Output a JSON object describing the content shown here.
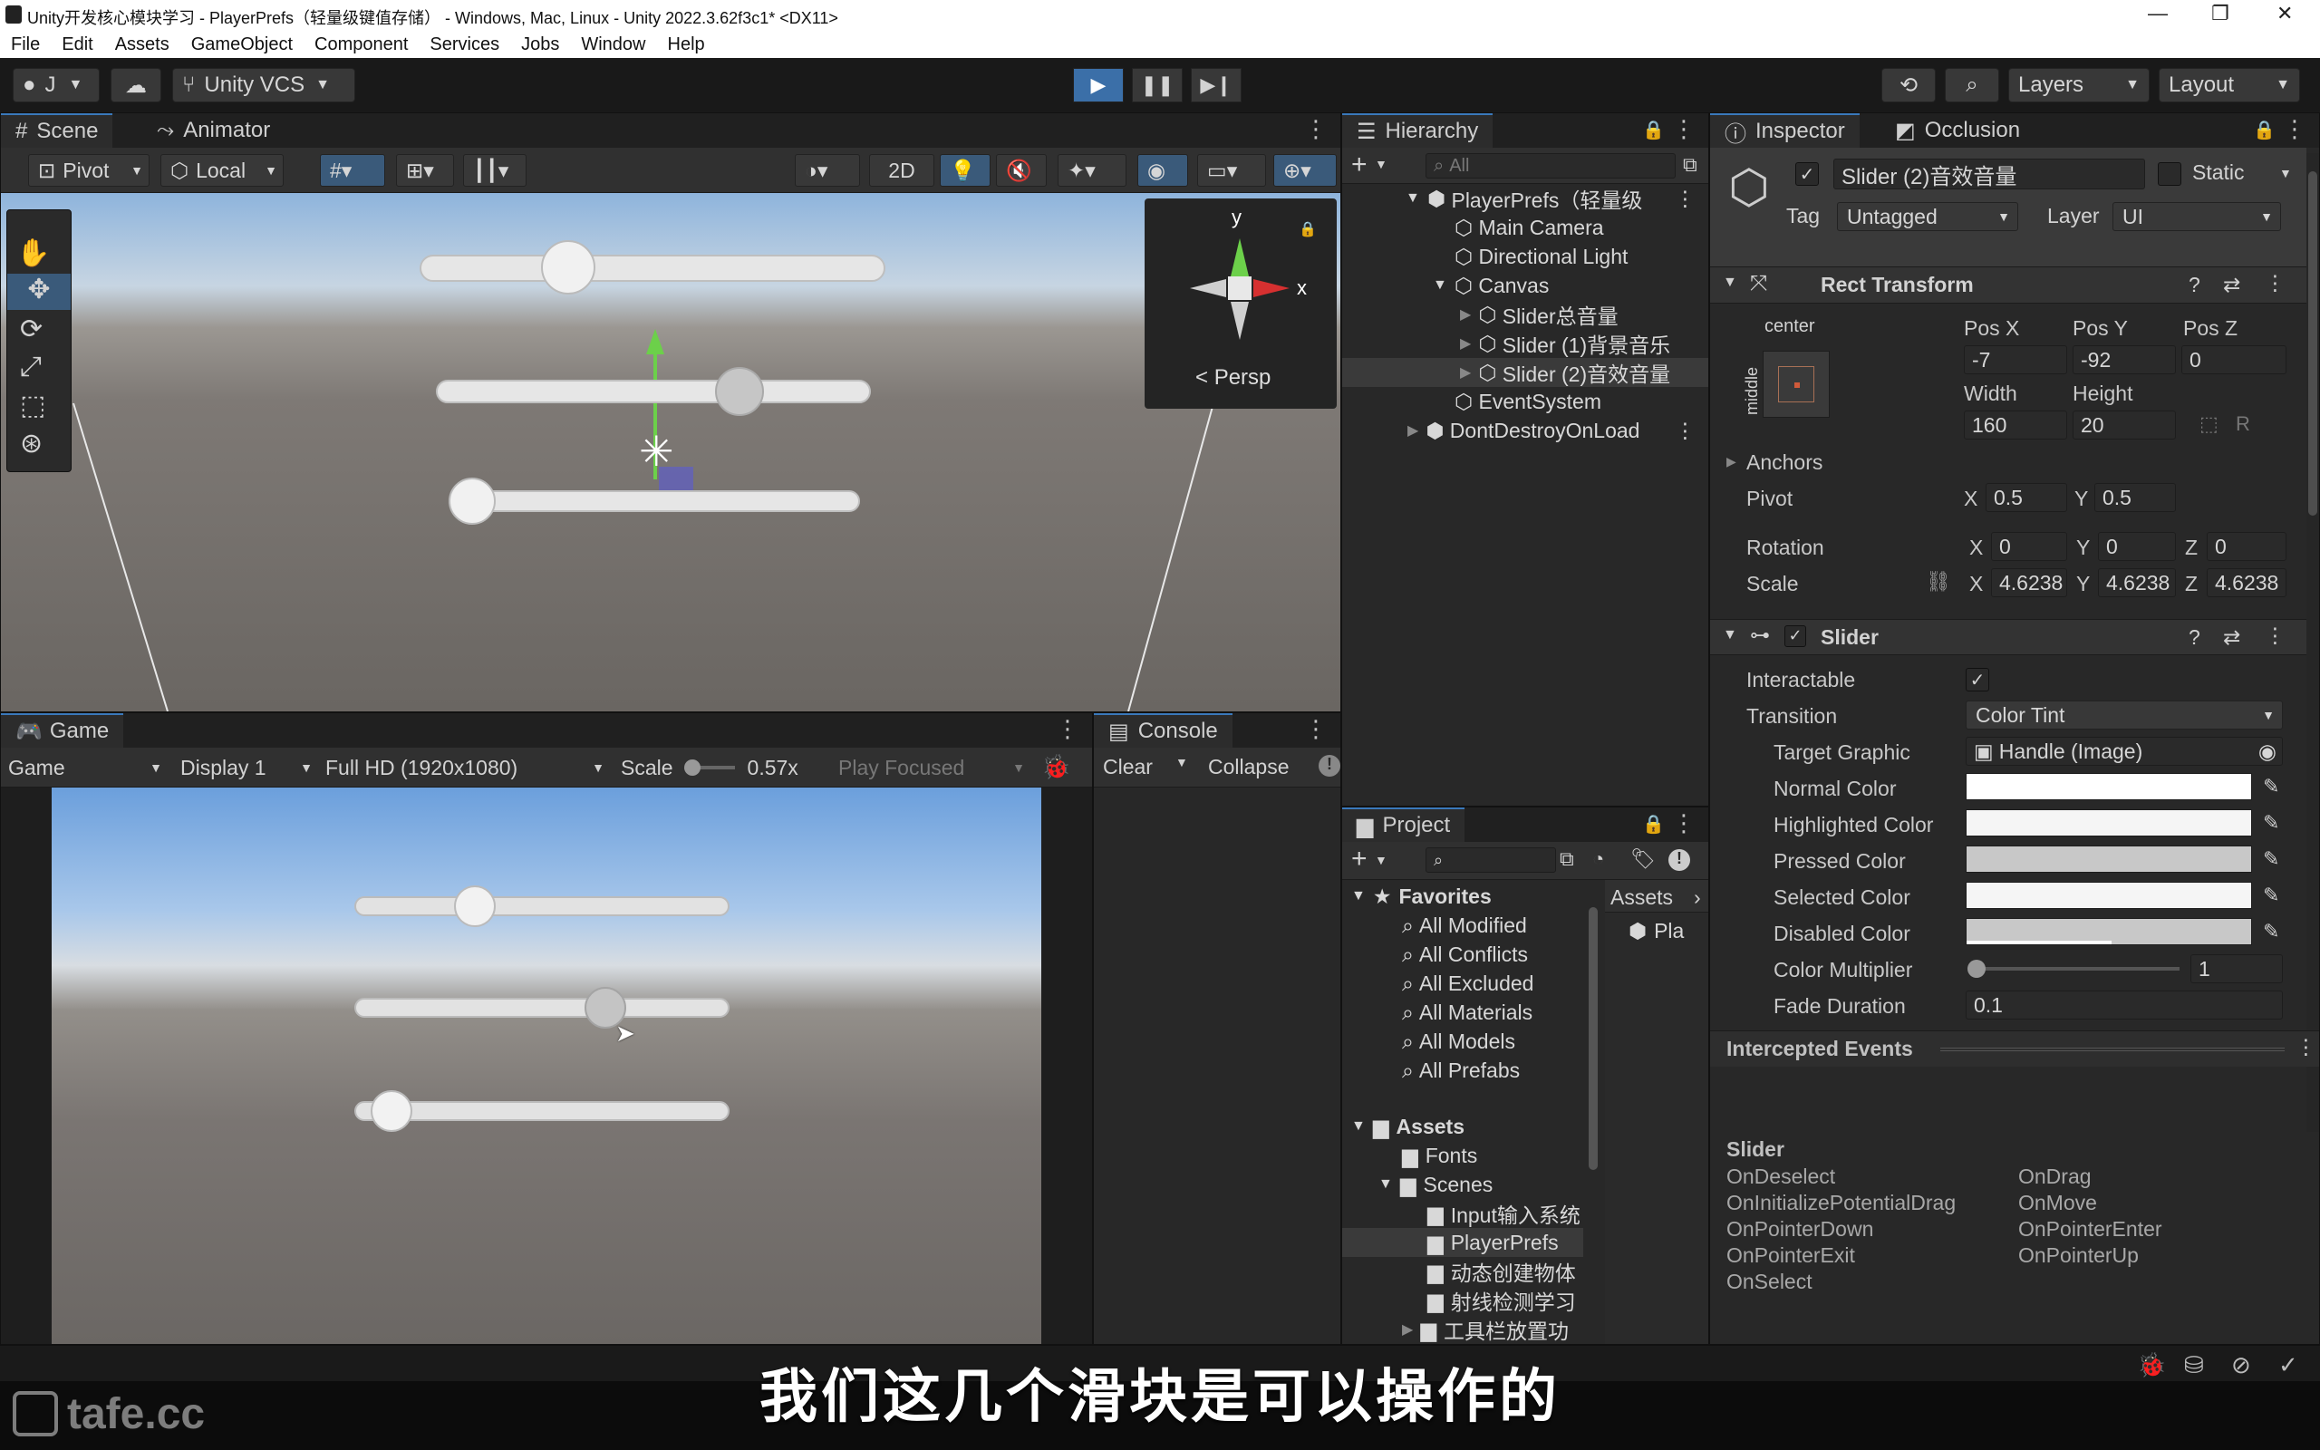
{
  "window": {
    "title": "Unity开发核心模块学习 - PlayerPrefs（轻量级键值存储） - Windows, Mac, Linux - Unity 2022.3.62f3c1* <DX11>"
  },
  "menu": [
    "File",
    "Edit",
    "Assets",
    "GameObject",
    "Component",
    "Services",
    "Jobs",
    "Window",
    "Help"
  ],
  "toolbar": {
    "account": "J",
    "vcs": "Unity VCS",
    "layers": "Layers",
    "layout": "Layout"
  },
  "scene": {
    "tabs": [
      "Scene",
      "Animator"
    ],
    "pivot": "Pivot",
    "local": "Local",
    "mode_2d": "2D",
    "persp": "Persp",
    "gizmo_y": "y",
    "gizmo_x": "x"
  },
  "game": {
    "tab": "Game",
    "mode": "Game",
    "display": "Display 1",
    "resolution": "Full HD (1920x1080)",
    "scale_label": "Scale",
    "scale_value": "0.57x",
    "play_focused": "Play Focused",
    "sliders": [
      0.3,
      0.69,
      0.05
    ]
  },
  "console": {
    "tab": "Console",
    "clear": "Clear",
    "collapse": "Collapse"
  },
  "hierarchy": {
    "tab": "Hierarchy",
    "search_placeholder": "All",
    "items": [
      {
        "label": "PlayerPrefs（轻量级",
        "indent": 0
      },
      {
        "label": "Main Camera",
        "indent": 1
      },
      {
        "label": "Directional Light",
        "indent": 1
      },
      {
        "label": "Canvas",
        "indent": 1
      },
      {
        "label": "Slider总音量",
        "indent": 2
      },
      {
        "label": "Slider (1)背景音乐",
        "indent": 2
      },
      {
        "label": "Slider (2)音效音量",
        "indent": 2
      },
      {
        "label": "EventSystem",
        "indent": 1
      },
      {
        "label": "DontDestroyOnLoad",
        "indent": 0
      }
    ]
  },
  "project": {
    "tab": "Project",
    "favorites_label": "Favorites",
    "favorites": [
      "All Modified",
      "All Conflicts",
      "All Excluded",
      "All Materials",
      "All Models",
      "All Prefabs"
    ],
    "assets_label": "Assets",
    "folders": [
      "Fonts",
      "Scenes"
    ],
    "scene_folders": [
      "Input输入系统",
      "PlayerPrefs",
      "动态创建物体",
      "射线检测学习",
      "工具栏放置功"
    ],
    "breadcrumb": "Assets",
    "asset_item": "Pla"
  },
  "inspector": {
    "tabs": [
      "Inspector",
      "Occlusion"
    ],
    "object_name": "Slider (2)音效音量",
    "static_label": "Static",
    "tag_label": "Tag",
    "tag_value": "Untagged",
    "layer_label": "Layer",
    "layer_value": "UI",
    "rect_transform": {
      "title": "Rect Transform",
      "anchor_h": "center",
      "anchor_v": "middle",
      "posx_label": "Pos X",
      "posx": "-7",
      "posy_label": "Pos Y",
      "posy": "-92",
      "posz_label": "Pos Z",
      "posz": "0",
      "width_label": "Width",
      "width": "160",
      "height_label": "Height",
      "height": "20",
      "anchors_label": "Anchors",
      "pivot_label": "Pivot",
      "pivot_x": "0.5",
      "pivot_y": "0.5",
      "rotation_label": "Rotation",
      "rot_x": "0",
      "rot_y": "0",
      "rot_z": "0",
      "scale_label": "Scale",
      "scale_x": "4.6238",
      "scale_y": "4.6238",
      "scale_z": "4.6238"
    },
    "slider": {
      "title": "Slider",
      "interactable_label": "Interactable",
      "transition_label": "Transition",
      "transition_value": "Color Tint",
      "target_graphic_label": "Target Graphic",
      "target_graphic_value": "Handle (Image)",
      "normal_color_label": "Normal Color",
      "highlighted_color_label": "Highlighted Color",
      "pressed_color_label": "Pressed Color",
      "selected_color_label": "Selected Color",
      "disabled_color_label": "Disabled Color",
      "color_multiplier_label": "Color Multiplier",
      "color_multiplier_value": "1",
      "fade_duration_label": "Fade Duration",
      "fade_duration_value": "0.1",
      "colors": {
        "normal": "#ffffff",
        "highlighted": "#f5f5f5",
        "pressed": "#c8c8c8",
        "selected": "#f5f5f5",
        "disabled": "#c8c8c8"
      }
    },
    "events": {
      "title": "Intercepted Events",
      "group": "Slider",
      "left": [
        "OnDeselect",
        "OnInitializePotentialDrag",
        "OnPointerDown",
        "OnPointerExit",
        "OnSelect"
      ],
      "right": [
        "OnDrag",
        "OnMove",
        "OnPointerEnter",
        "OnPointerUp"
      ]
    }
  },
  "subtitle": "我们这几个滑块是可以操作的",
  "watermark": "tafe.cc",
  "accent": "#3a79bb"
}
